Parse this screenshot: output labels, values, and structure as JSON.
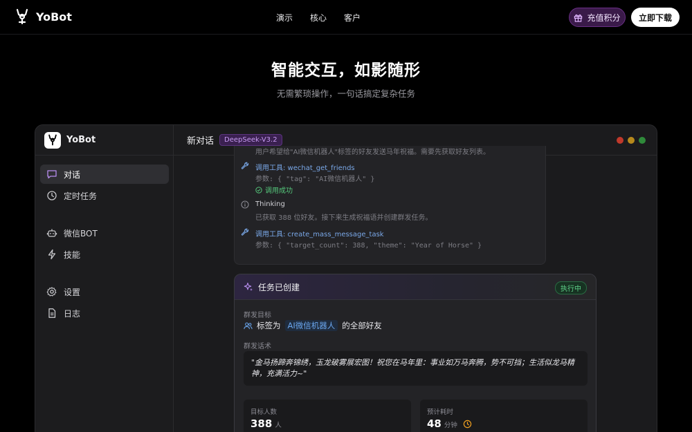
{
  "brand": {
    "name": "YoBot"
  },
  "nav": {
    "links": [
      "演示",
      "核心",
      "客户"
    ]
  },
  "header_buttons": {
    "recharge": "充值积分",
    "download": "立即下载"
  },
  "hero": {
    "title": "智能交互，如影随形",
    "subtitle": "无需繁琐操作，一句话搞定复杂任务"
  },
  "app": {
    "sidebar": {
      "title": "YoBot",
      "items": [
        {
          "label": "对话",
          "icon": "chat-icon",
          "active": true
        },
        {
          "label": "定时任务",
          "icon": "clock-icon"
        },
        {
          "label": "微信BOT",
          "icon": "robot-icon"
        },
        {
          "label": "技能",
          "icon": "lightning-icon"
        },
        {
          "label": "设置",
          "icon": "gear-icon"
        },
        {
          "label": "日志",
          "icon": "document-icon"
        }
      ]
    },
    "main": {
      "title": "新对话",
      "model": "DeepSeek-V3.2",
      "window_dots": [
        "#c0392b",
        "#b7891c",
        "#2f8a3a"
      ]
    },
    "log": {
      "line0": "用户希望给\"AI微信机器人\"标签的好友发送马年祝福。需要先获取好友列表。",
      "tool1": "调用工具: wechat_get_friends",
      "params1": "参数: { \"tag\": \"AI微信机器人\" }",
      "success": "调用成功",
      "thinking": "Thinking",
      "thinking_text": "已获取 388 位好友。接下来生成祝福语并创建群发任务。",
      "tool2": "调用工具: create_mass_message_task",
      "params2": "参数: { \"target_count\": 388, \"theme\": \"Year of Horse\" }"
    },
    "task": {
      "title": "任务已创建",
      "status": "执行中",
      "target_label": "群发目标",
      "target_prefix": "标签为",
      "target_tag": "AI微信机器人",
      "target_suffix": "的全部好友",
      "script_label": "群发话术",
      "script_text": "\"金马扬蹄奔锦绣，玉龙破雾展宏图！祝您在马年里：事业如万马奔腾，势不可挡；生活似龙马精神，充满活力~\"",
      "stats": [
        {
          "label": "目标人数",
          "value": "388",
          "unit": "人"
        },
        {
          "label": "预计耗时",
          "value": "48",
          "unit": "分钟"
        }
      ]
    }
  },
  "colors": {
    "accent_purple": "#9b5de5",
    "tool_blue": "#7aa8e8",
    "success_green": "#54c57a",
    "clock_orange": "#f0a020"
  }
}
